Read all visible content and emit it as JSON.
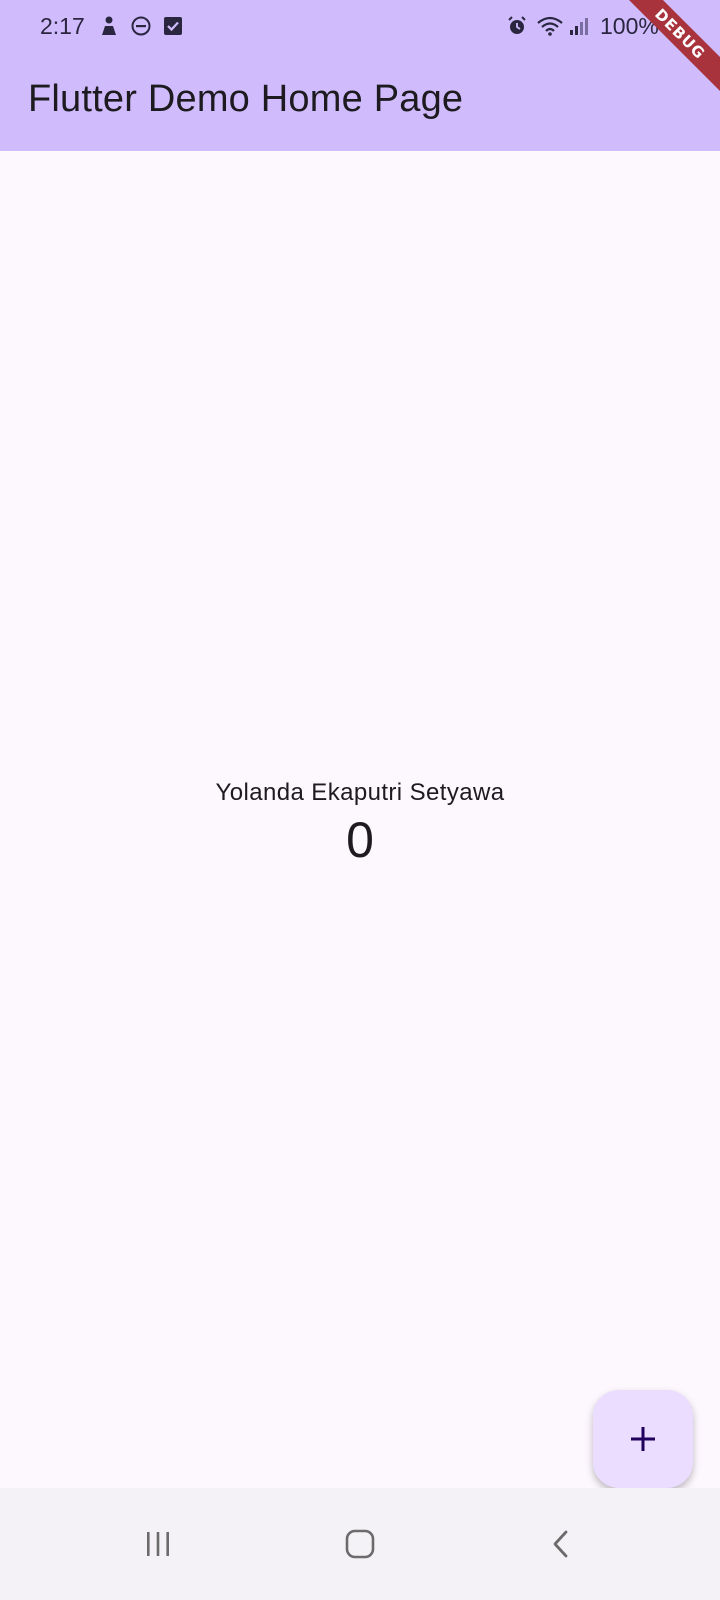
{
  "status_bar": {
    "time": "2:17",
    "battery": "100%",
    "left_icons": [
      "person-notification-icon",
      "do-not-disturb-icon",
      "checkbox-notification-icon"
    ],
    "right_icons": [
      "alarm-icon",
      "wifi-icon",
      "signal-icon",
      "battery-icon"
    ]
  },
  "app_bar": {
    "title": "Flutter Demo Home Page",
    "color": "#D0BCFD"
  },
  "debug_banner": {
    "label": "DEBUG",
    "color": "#A8333D"
  },
  "main": {
    "name": "Yolanda Ekaputri Setyawa",
    "counter": "0",
    "background": "#FDF7FE"
  },
  "fab": {
    "icon": "plus-icon",
    "color": "#EADDFF"
  },
  "nav_bar": {
    "buttons": [
      "recent-apps-icon",
      "home-icon",
      "back-icon"
    ]
  }
}
